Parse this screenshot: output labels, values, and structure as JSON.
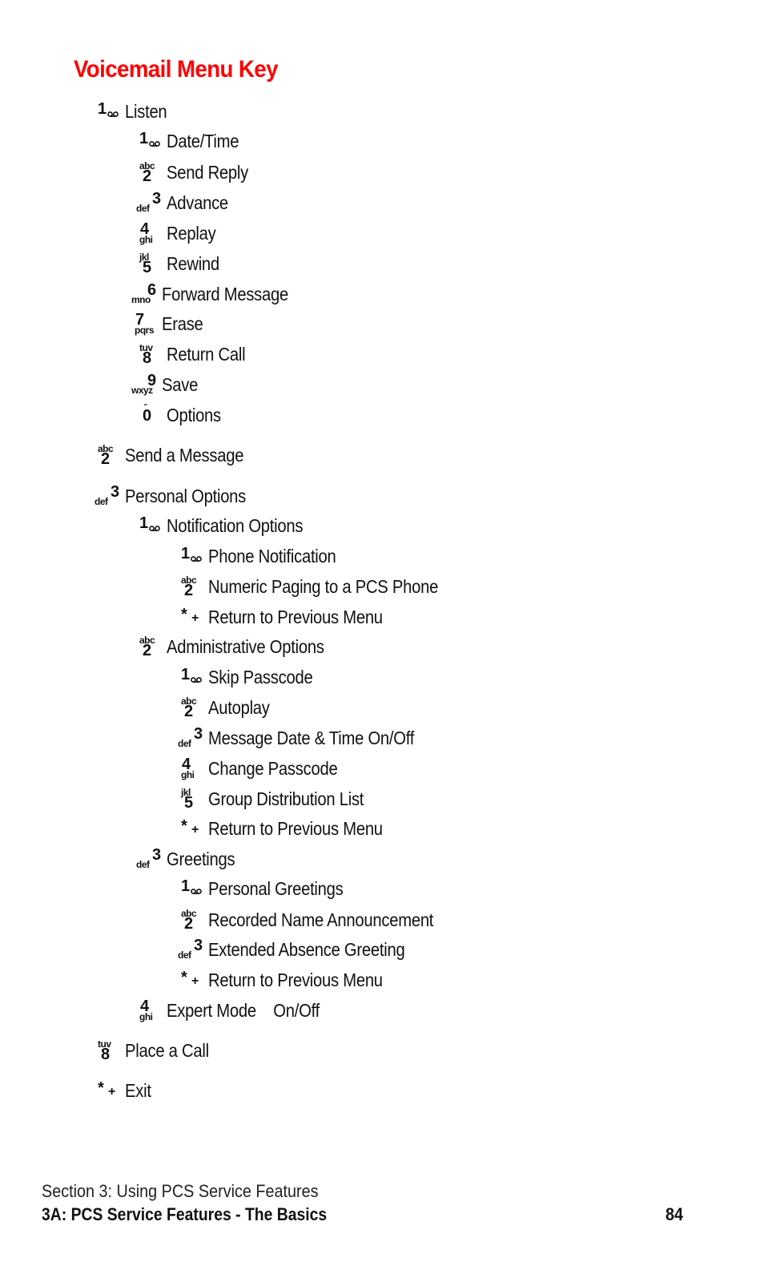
{
  "title": "Voicemail Menu Key",
  "keys": {
    "1": {
      "digit": "1",
      "letters": "",
      "icon": "voicemail-icon"
    },
    "2": {
      "digit": "2",
      "letters": "abc"
    },
    "3": {
      "digit": "3",
      "letters": "def"
    },
    "4": {
      "digit": "4",
      "letters": "ghi"
    },
    "5": {
      "digit": "5",
      "letters": "jkl"
    },
    "6": {
      "digit": "6",
      "letters": "mno"
    },
    "7": {
      "digit": "7",
      "letters": "pqrs"
    },
    "8": {
      "digit": "8",
      "letters": "tuv"
    },
    "9": {
      "digit": "9",
      "letters": "wxyz"
    },
    "0": {
      "digit": "0",
      "letters": ""
    },
    "star": {
      "digit": "*",
      "letters": "+"
    }
  },
  "menu": [
    {
      "key": "1",
      "label": "Listen",
      "level": 0
    },
    {
      "key": "1",
      "label": "Date/Time",
      "level": 1
    },
    {
      "key": "2",
      "label": "Send Reply",
      "level": 1
    },
    {
      "key": "3",
      "label": "Advance",
      "level": 1
    },
    {
      "key": "4",
      "label": "Replay",
      "level": 1
    },
    {
      "key": "5",
      "label": "Rewind",
      "level": 1
    },
    {
      "key": "6",
      "label": "Forward Message",
      "level": 1
    },
    {
      "key": "7",
      "label": "Erase",
      "level": 1
    },
    {
      "key": "8",
      "label": "Return Call",
      "level": 1
    },
    {
      "key": "9",
      "label": "Save",
      "level": 1
    },
    {
      "key": "0",
      "label": "Options",
      "level": 1
    },
    {
      "key": "2",
      "label": "Send a Message",
      "level": 0
    },
    {
      "key": "3",
      "label": "Personal Options",
      "level": 0
    },
    {
      "key": "1",
      "label": "Notification Options",
      "level": 1
    },
    {
      "key": "1",
      "label": "Phone Notification",
      "level": 2
    },
    {
      "key": "2",
      "label": "Numeric Paging to a PCS Phone",
      "level": 2
    },
    {
      "key": "star",
      "label": "Return to Previous Menu",
      "level": 2
    },
    {
      "key": "2",
      "label": "Administrative Options",
      "level": 1
    },
    {
      "key": "1",
      "label": "Skip Passcode",
      "level": 2
    },
    {
      "key": "2",
      "label": "Autoplay",
      "level": 2
    },
    {
      "key": "3",
      "label": "Message Date & Time On/Off",
      "level": 2
    },
    {
      "key": "4",
      "label": "Change Passcode",
      "level": 2
    },
    {
      "key": "5",
      "label": "Group Distribution List",
      "level": 2
    },
    {
      "key": "star",
      "label": "Return to Previous Menu",
      "level": 2
    },
    {
      "key": "3",
      "label": "Greetings",
      "level": 1
    },
    {
      "key": "1",
      "label": "Personal Greetings",
      "level": 2
    },
    {
      "key": "2",
      "label": "Recorded Name Announcement",
      "level": 2
    },
    {
      "key": "3",
      "label": "Extended Absence Greeting",
      "level": 2
    },
    {
      "key": "star",
      "label": "Return to Previous Menu",
      "level": 2
    },
    {
      "key": "4",
      "label": "Expert Mode    On/Off",
      "level": 1
    },
    {
      "key": "8",
      "label": "Place a Call",
      "level": 0
    },
    {
      "key": "star",
      "label": "Exit",
      "level": 0
    }
  ],
  "footer": {
    "section": "Section 3: Using PCS Service Features",
    "chapter": "3A: PCS Service Features - The Basics",
    "page": "84"
  }
}
